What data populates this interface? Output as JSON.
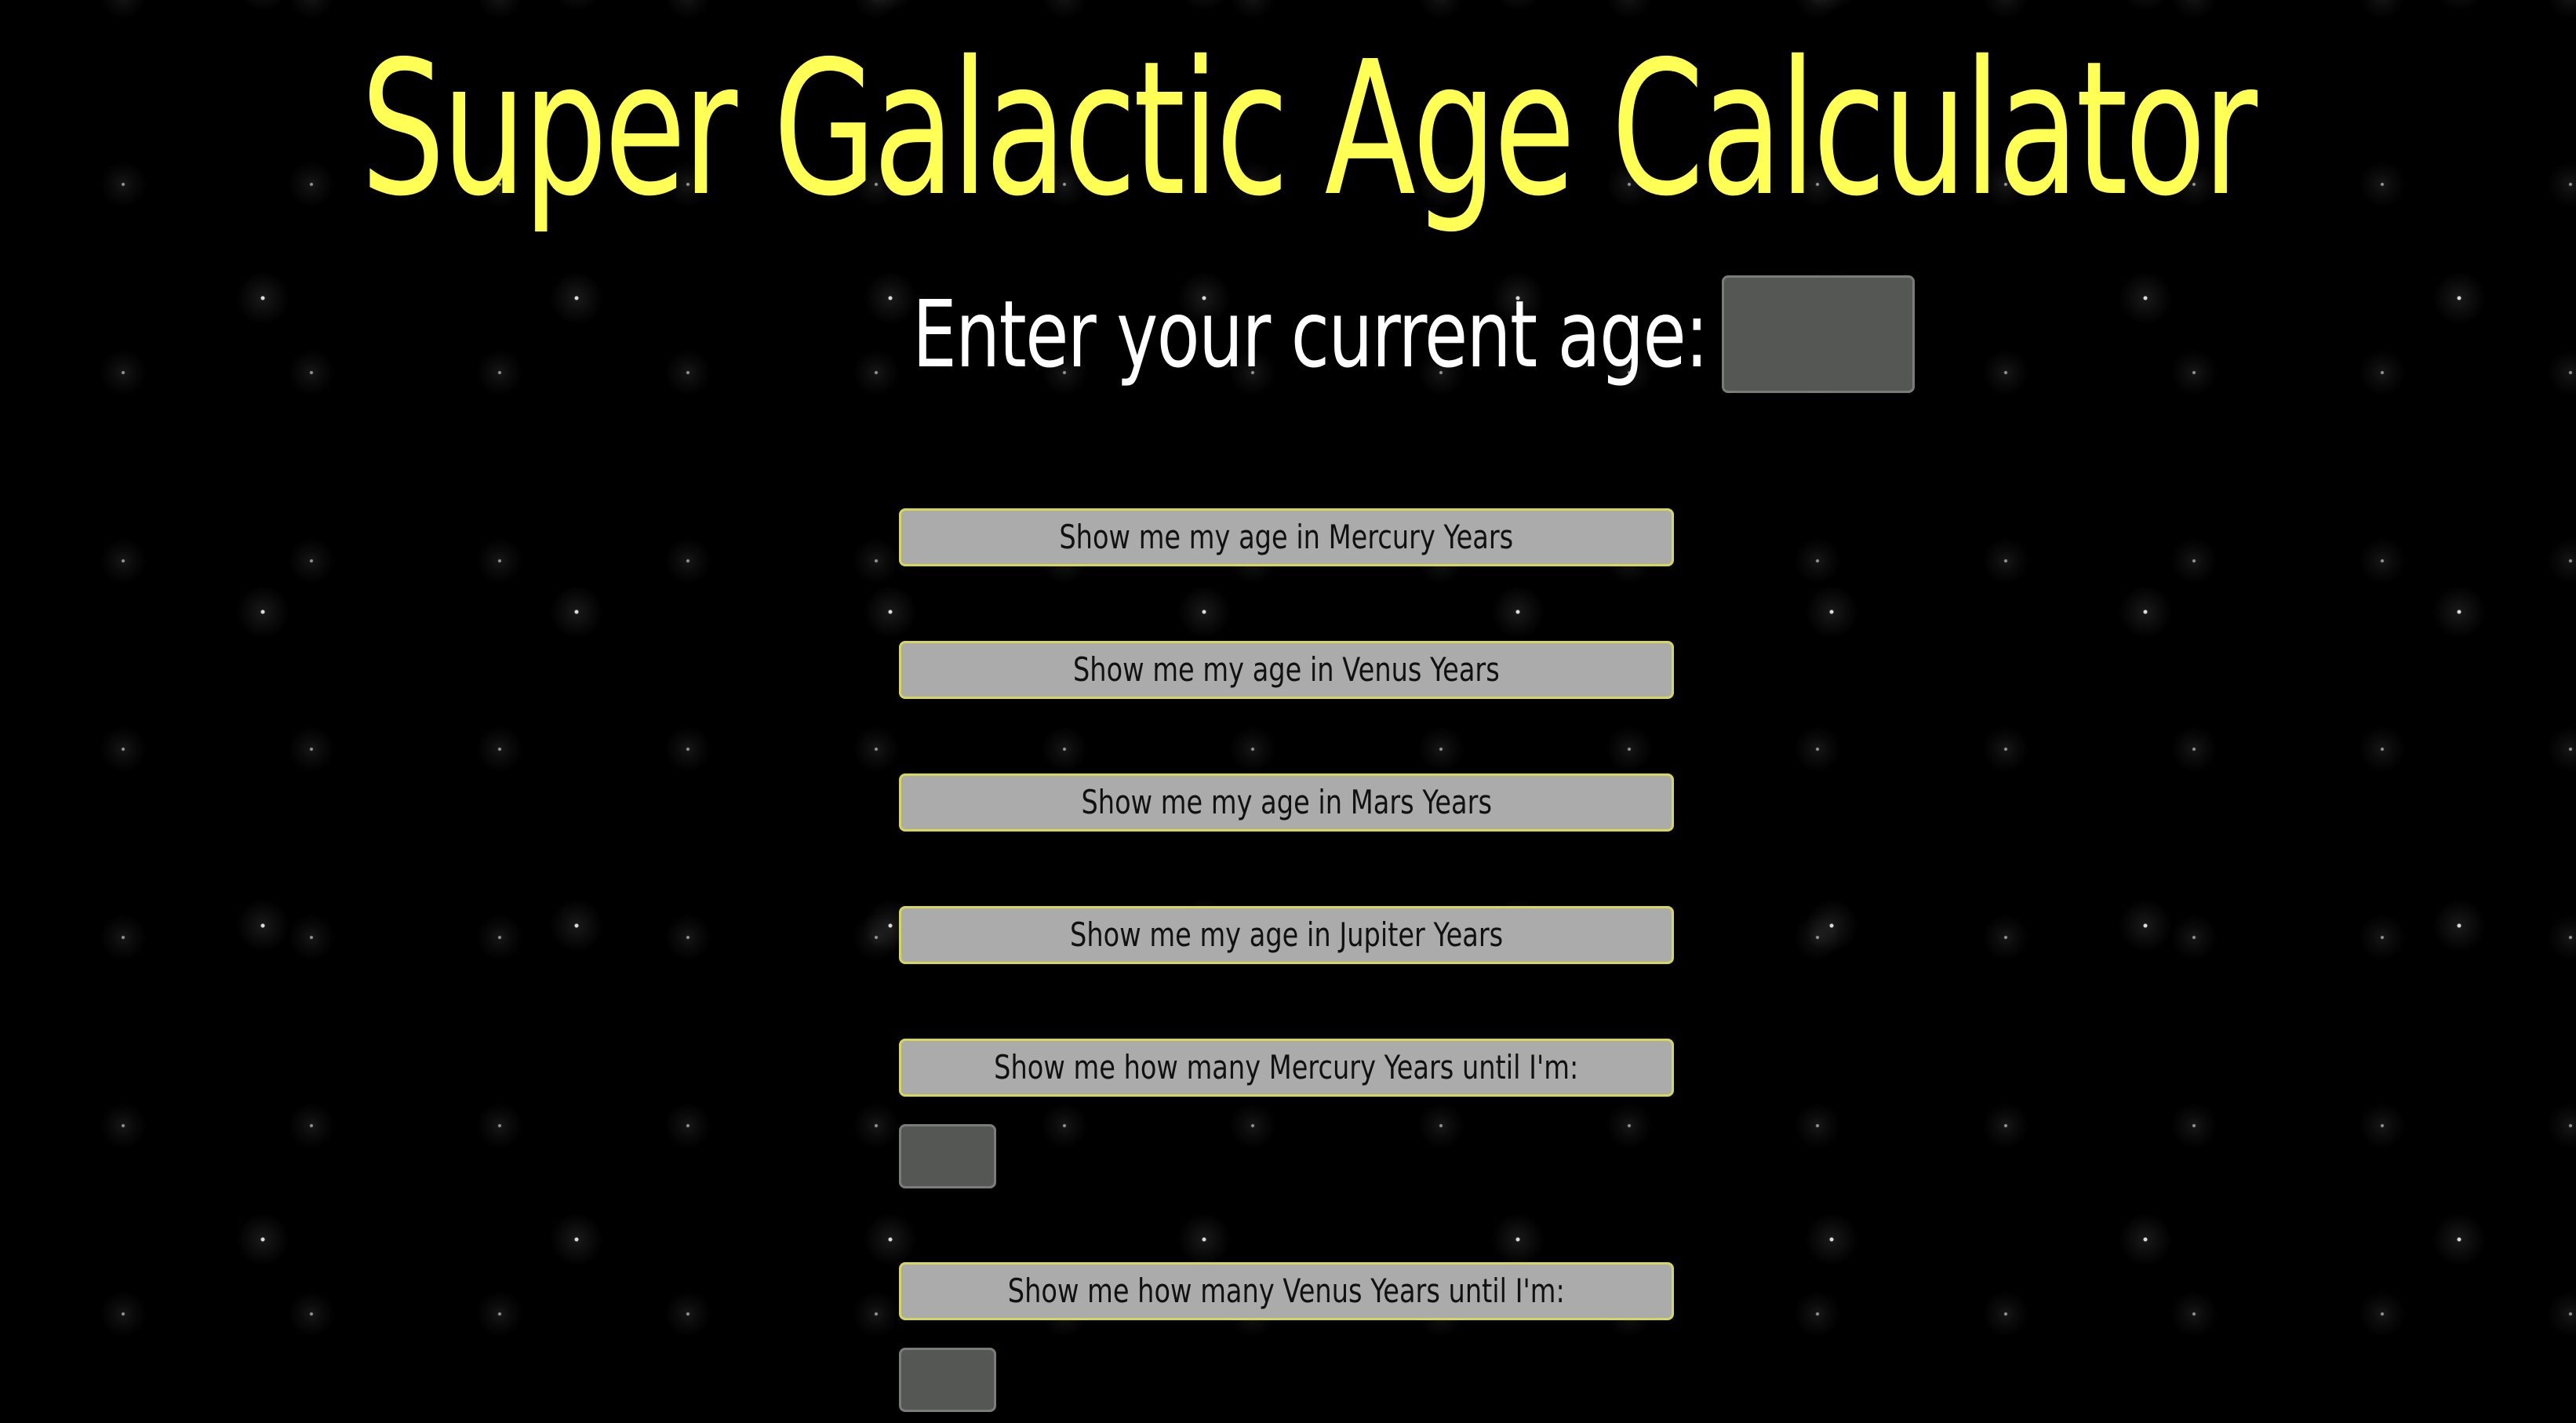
{
  "header": {
    "title": "Super Galactic Age Calculator"
  },
  "age_input": {
    "label": "Enter your current age:",
    "value": ""
  },
  "buttons": [
    {
      "label": "Show me my age in Mercury Years"
    },
    {
      "label": "Show me my age in Venus Years"
    },
    {
      "label": "Show me my age in Mars Years"
    },
    {
      "label": "Show me my age in Jupiter Years"
    },
    {
      "label": "Show me how many Mercury Years until I'm:"
    },
    {
      "label": "Show me how many Venus Years until I'm:"
    }
  ],
  "until_inputs": [
    {
      "value": ""
    },
    {
      "value": ""
    }
  ],
  "colors": {
    "background": "#000000",
    "title": "#ffff55",
    "button_bg": "#ababab",
    "button_border": "#d6d65a",
    "input_bg": "#555755"
  }
}
